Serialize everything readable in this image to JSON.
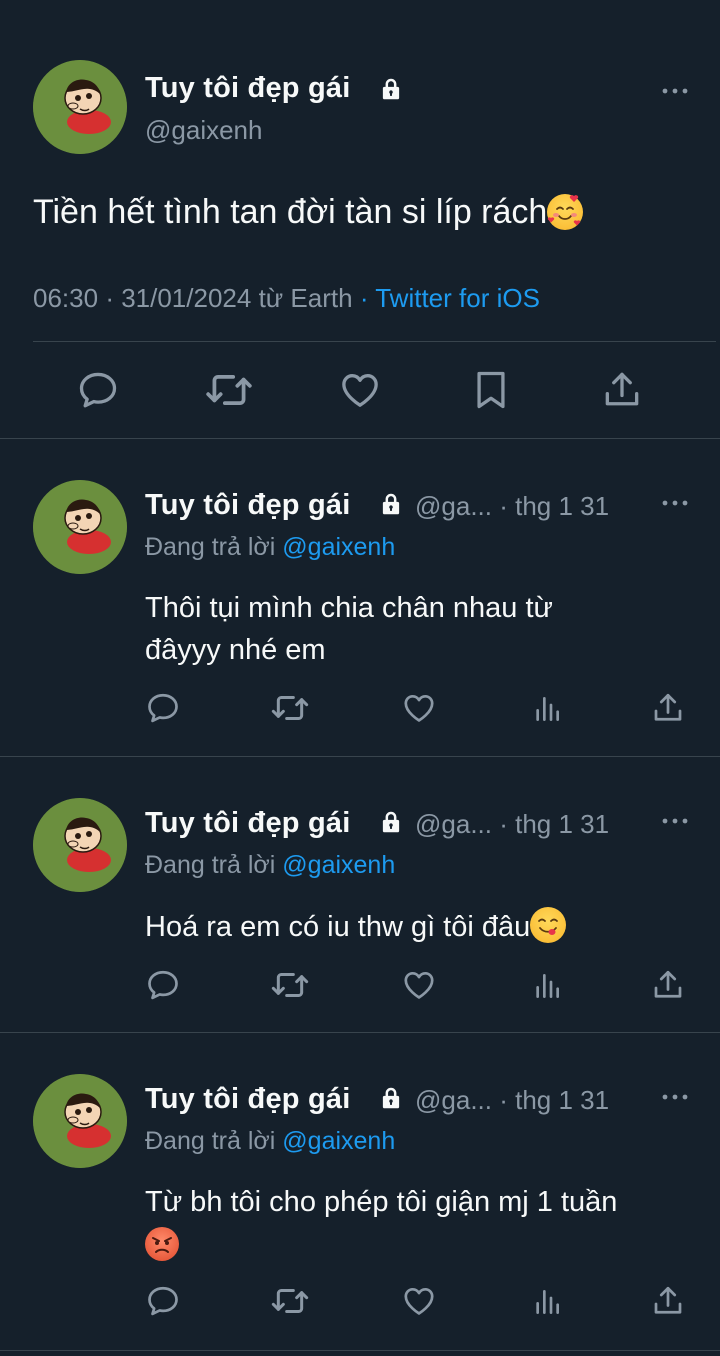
{
  "main_tweet": {
    "display_name": "Tuy tôi đẹp gái",
    "handle": "@gaixenh",
    "text": "Tiền hết tình tan đời tàn si líp rách",
    "emoji": "smiling-face-with-hearts",
    "time": "06:30",
    "date": "31/01/2024",
    "location": "từ Earth",
    "source": "Twitter for iOS"
  },
  "replies": [
    {
      "display_name": "Tuy tôi đẹp gái",
      "handle_short": "@ga...",
      "date": "thg 1 31",
      "replying_prefix": "Đang trả lời ",
      "replying_to": "@gaixenh",
      "text_line1": "Thôi tụi mình chia chân nhau từ",
      "text_line2": "đâyyy nhé em"
    },
    {
      "display_name": "Tuy tôi đẹp gái",
      "handle_short": "@ga...",
      "date": "thg 1 31",
      "replying_prefix": "Đang trả lời ",
      "replying_to": "@gaixenh",
      "text_line1": "Hoá ra em có iu thw gì tôi đâu",
      "emoji": "face-savoring-food"
    },
    {
      "display_name": "Tuy tôi đẹp gái",
      "handle_short": "@ga...",
      "date": "thg 1 31",
      "replying_prefix": "Đang trả lời ",
      "replying_to": "@gaixenh",
      "text_line1": "Từ bh tôi cho phép tôi giận mj 1 tuần",
      "emoji": "angry-face"
    }
  ],
  "colors": {
    "background": "#15202b",
    "text": "#f7f9f9",
    "secondary": "#8b98a5",
    "accent": "#1d9bf0",
    "divider": "#38444d"
  }
}
